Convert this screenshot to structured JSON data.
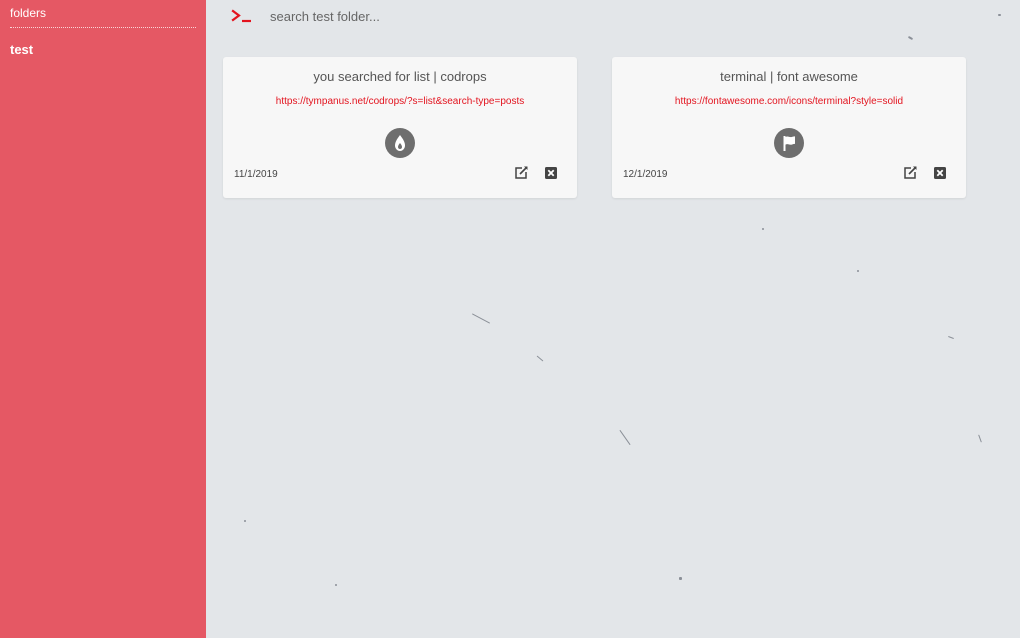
{
  "sidebar": {
    "header": "folders",
    "items": [
      {
        "label": "test"
      }
    ]
  },
  "search": {
    "icon": "terminal-prompt-icon",
    "placeholder": "search test folder..."
  },
  "cards": [
    {
      "title": "you searched for list | codrops",
      "url": "https://tympanus.net/codrops/?s=list&search-type=posts",
      "icon": "fire-drop-icon",
      "date": "11/1/2019",
      "actions": [
        "edit-icon",
        "delete-icon"
      ]
    },
    {
      "title": "terminal | font awesome",
      "url": "https://fontawesome.com/icons/terminal?style=solid",
      "icon": "flag-icon",
      "date": "12/1/2019",
      "actions": [
        "edit-icon",
        "delete-icon"
      ]
    }
  ],
  "colors": {
    "sidebar": "#e55864",
    "background": "#e3e6e9",
    "accent": "#e3141f",
    "badge": "#6e6e6e"
  }
}
